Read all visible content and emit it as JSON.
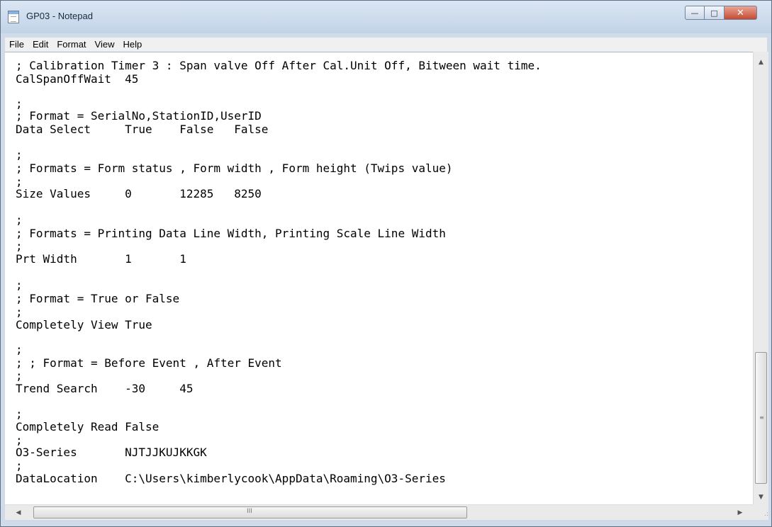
{
  "window": {
    "title": "GP03 - Notepad",
    "buttons": {
      "minimize": "—",
      "maximize": "□",
      "close": "✕"
    }
  },
  "menu": [
    "File",
    "Edit",
    "Format",
    "View",
    "Help"
  ],
  "lines": [
    "; Calibration Timer 3 : Span valve Off After Cal.Unit Off, Bitween wait time.",
    "CalSpanOffWait  45",
    ";",
    "; Format = SerialNo,StationID,UserID",
    "Data Select     True    False   False",
    ";",
    "; Formats = Form status , Form width , Form height (Twips value)",
    ";",
    "Size Values     0       12285   8250",
    ";",
    "; Formats = Printing Data Line Width, Printing Scale Line Width",
    ";",
    "Prt Width       1       1",
    ";",
    "; Format = True or False",
    ";",
    "Completely View True",
    ";",
    "; ; Format = Before Event , After Event",
    ";",
    "Trend Search    -30     45",
    ";",
    "Completely Read False",
    ";",
    "O3-Series       NJTJJKUJKKGK",
    ";",
    "DataLocation    C:\\Users\\kimberlycook\\AppData\\Roaming\\O3-Series"
  ],
  "scrollbar": {
    "up_arrow": "▲",
    "down_arrow": "▼",
    "left_arrow": "◀",
    "right_arrow": "▶",
    "v_grip": "≡",
    "h_grip": "III",
    "size_grip": ".:"
  }
}
